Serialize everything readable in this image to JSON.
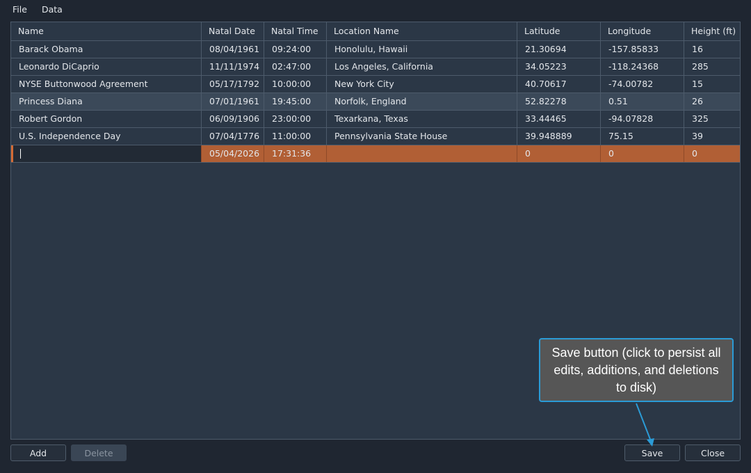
{
  "menu": {
    "file": "File",
    "data": "Data"
  },
  "table": {
    "headers": [
      "Name",
      "Natal Date",
      "Natal Time",
      "Location Name",
      "Latitude",
      "Longitude",
      "Height (ft)"
    ],
    "rows": [
      [
        "Barack Obama",
        "08/04/1961",
        "09:24:00",
        "Honolulu, Hawaii",
        "21.30694",
        "-157.85833",
        "16"
      ],
      [
        "Leonardo DiCaprio",
        "11/11/1974",
        "02:47:00",
        "Los Angeles, California",
        "34.05223",
        "-118.24368",
        "285"
      ],
      [
        "NYSE Buttonwood Agreement",
        "05/17/1792",
        "10:00:00",
        "New York City",
        "40.70617",
        "-74.00782",
        "15"
      ],
      [
        "Princess Diana",
        "07/01/1961",
        "19:45:00",
        "Norfolk, England",
        "52.82278",
        "0.51",
        "26"
      ],
      [
        "Robert Gordon",
        "06/09/1906",
        "23:00:00",
        "Texarkana, Texas",
        "33.44465",
        "-94.07828",
        "325"
      ],
      [
        "U.S. Independence Day",
        "07/04/1776",
        "11:00:00",
        "Pennsylvania State House",
        "39.948889",
        "75.15",
        "39"
      ]
    ],
    "new_row": [
      "",
      "05/04/2026",
      "17:31:36",
      "",
      "0",
      "0",
      "0"
    ],
    "selected_row": "Princess Diana"
  },
  "buttons": {
    "add": "Add",
    "delete": "Delete",
    "save": "Save",
    "close": "Close"
  },
  "callout": {
    "text": "Save button (click to persist all edits, additions, and deletions to disk)"
  },
  "colors": {
    "background": "#1f2631",
    "grid": "#2b3746",
    "selected_row": "#3b4959",
    "new_row": "#b15f35",
    "callout_border": "#2b9bd6",
    "callout_fill": "#565656"
  }
}
